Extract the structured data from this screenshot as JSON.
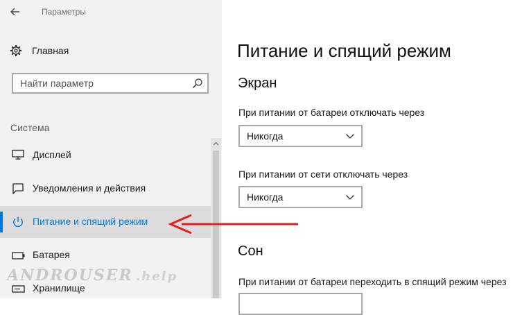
{
  "window": {
    "title": "Параметры"
  },
  "sidebar": {
    "home_label": "Главная",
    "search": {
      "placeholder": "Найти параметр",
      "value": ""
    },
    "section_label": "Система",
    "items": [
      {
        "label": "Дисплей",
        "icon": "monitor-icon",
        "active": false
      },
      {
        "label": "Уведомления и действия",
        "icon": "notification-icon",
        "active": false
      },
      {
        "label": "Питание и спящий режим",
        "icon": "power-icon",
        "active": true
      },
      {
        "label": "Батарея",
        "icon": "battery-icon",
        "active": false
      },
      {
        "label": "Хранилище",
        "icon": "storage-icon",
        "active": false
      }
    ]
  },
  "watermark": {
    "text": "ANDROUSER",
    "tld": ".help"
  },
  "main": {
    "title": "Питание и спящий режим",
    "screen": {
      "title": "Экран",
      "battery_label": "При питании от батареи отключать через",
      "battery_value": "Никогда",
      "plugged_label": "При питании от сети отключать через",
      "plugged_value": "Никогда"
    },
    "sleep": {
      "title": "Сон",
      "battery_label": "При питании от батареи переходить в спящий режим через"
    }
  },
  "colors": {
    "accent": "#0078d7",
    "annotation_arrow": "#e02020",
    "sidebar_bg": "#f2f2f2"
  }
}
